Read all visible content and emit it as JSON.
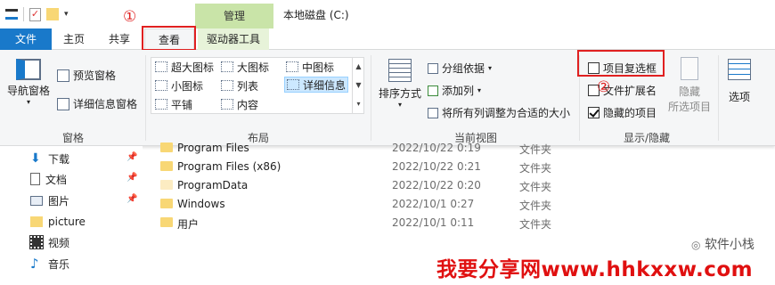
{
  "titlebar": {
    "context_tab": "管理",
    "window_title": "本地磁盘 (C:)"
  },
  "tabs": {
    "file": "文件",
    "home": "主页",
    "share": "共享",
    "view": "查看",
    "drive_tools": "驱动器工具"
  },
  "annotations": {
    "num1": "①",
    "num2": "②"
  },
  "ribbon": {
    "panes": {
      "nav_pane": "导航窗格",
      "preview_pane": "预览窗格",
      "details_pane": "详细信息窗格",
      "label": "窗格"
    },
    "layout": {
      "items": [
        "超大图标",
        "大图标",
        "中图标",
        "小图标",
        "列表",
        "详细信息",
        "平铺",
        "内容"
      ],
      "label": "布局"
    },
    "current_view": {
      "sort": "排序方式",
      "group_by": "分组依据",
      "add_column": "添加列",
      "fit_columns": "将所有列调整为合适的大小",
      "label": "当前视图"
    },
    "show_hide": {
      "item_checkboxes": "项目复选框",
      "file_extensions": "文件扩展名",
      "hidden_items": "隐藏的项目",
      "hide_selected_1": "隐藏",
      "hide_selected_2": "所选项目",
      "label": "显示/隐藏"
    },
    "options": "选项"
  },
  "nav_pane": {
    "items": [
      "下载",
      "文档",
      "图片",
      "picture",
      "视频",
      "音乐"
    ]
  },
  "files": [
    {
      "name": "Program Files",
      "date": "2022/10/22 0:19",
      "type": "文件夹"
    },
    {
      "name": "Program Files (x86)",
      "date": "2022/10/22 0:21",
      "type": "文件夹"
    },
    {
      "name": "ProgramData",
      "date": "2022/10/22 0:20",
      "type": "文件夹"
    },
    {
      "name": "Windows",
      "date": "2022/10/1 0:27",
      "type": "文件夹"
    },
    {
      "name": "用户",
      "date": "2022/10/1 0:11",
      "type": "文件夹"
    }
  ],
  "watermarks": {
    "wechat": "软件小栈",
    "site": "我要分享网www.hhkxxw.com"
  }
}
